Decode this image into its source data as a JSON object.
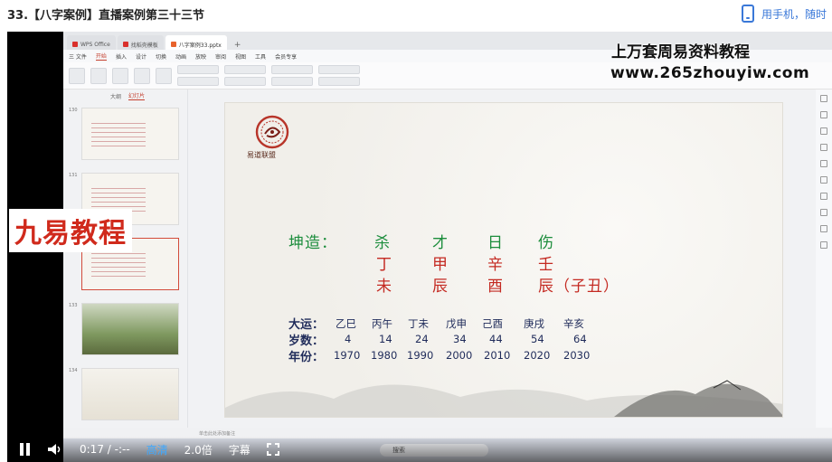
{
  "page": {
    "title": "33.【八字案例】直播案例第三十三节",
    "mobile_link": "用手机，随时"
  },
  "watermarks": {
    "line1": "上万套周易资料教程",
    "line2": "www.265zhouyiw.com",
    "badge": "九易教程"
  },
  "app": {
    "tabs": [
      {
        "label": "WPS Office"
      },
      {
        "label": "找稻壳模板"
      },
      {
        "label": "八字案例33.pptx"
      }
    ],
    "menu": [
      "三 文件",
      "开始",
      "插入",
      "设计",
      "切换",
      "动画",
      "放映",
      "审阅",
      "视图",
      "工具",
      "会员专享"
    ],
    "active_menu": "开始",
    "panel_tabs": [
      "大纲",
      "幻灯片"
    ],
    "slides": [
      {
        "num": "130"
      },
      {
        "num": "131"
      },
      {
        "num": "132"
      },
      {
        "num": "133"
      },
      {
        "num": "134"
      }
    ],
    "status_text": "单击此处添加备注",
    "taskbar_search": "搜索"
  },
  "slide": {
    "logo_text": "易道联盟",
    "chart_label": "坤造：",
    "ten_gods": [
      "杀",
      "才",
      "日",
      "伤"
    ],
    "stems": [
      "丁",
      "甲",
      "辛",
      "壬"
    ],
    "branches": [
      "未",
      "辰",
      "酉",
      "辰（子丑）"
    ],
    "luck_labels": {
      "dayun": "大运：",
      "age": "岁数：",
      "year": "年份："
    },
    "dayun": [
      "乙巳",
      "丙午",
      "丁未",
      "戊申",
      "己酉",
      "庚戌",
      "辛亥"
    ],
    "ages": [
      "4",
      "14",
      "24",
      "34",
      "44",
      "54",
      "64"
    ],
    "years": [
      "1970",
      "1980",
      "1990",
      "2000",
      "2010",
      "2020",
      "2030"
    ]
  },
  "player": {
    "time": "0:17 / -:--",
    "quality": "高清",
    "speed": "2.0倍",
    "subtitle": "字幕"
  }
}
